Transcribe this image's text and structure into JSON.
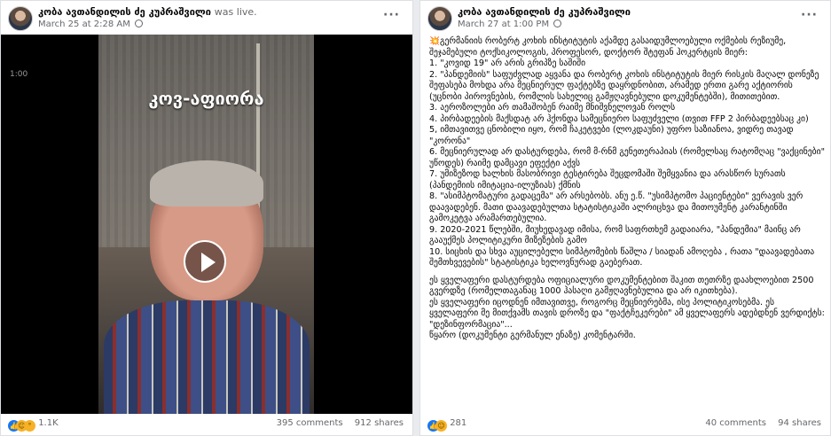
{
  "left_post": {
    "author": "კობა ავთანდილის ძე კუპრაშვილი",
    "status": "was live.",
    "timestamp": "March 25 at 2:28 AM",
    "video": {
      "overlay_title": "კოვ-აფიორა",
      "timecode": "1:00"
    },
    "reactions_count": "1.1K",
    "reactions_icons": [
      "like-icon",
      "haha-icon",
      "wow-icon"
    ],
    "comments": "395 comments",
    "shares": "912 shares"
  },
  "right_post": {
    "author": "კობა ავთანდილის ძე კუპრაშვილი",
    "timestamp": "March 27 at 1:00 PM",
    "paragraphs": [
      "💥გერმანიის რობერტ კოხის ინსტიტუტის აქამდე გასაიდუმლოებული ოქმების რეზიუმე, შეჯამებული ტოქსიკოლოგის, პროფესორ, დოქტორ შტეფან ჰოკერტცის მიერ:",
      "1. \"კოვიდ 19\" არ არის გრიპზე საშიში",
      "2. \"პანდემიის\" საფუძვლად აყვანა და რობერტ კოხის ინსტიტუტის მიერ რისკის მაღალ დონეზე შეფასება მოხდა არა მეცნიერულ ფაქტებზე დაყრდნობით, არამედ ერთი გარე აქტიორის (უცნობი პიროვნების, რომლის სახელიც გამჟღავნებული დოკუმენტებში), მითითებით.",
      "3. აეროზოლები არ თამაშობენ რაიმე მნიშვნელოვან როლს",
      "4. პირბადეების მაქსდატ არ ჰქონდა სამეცნიერო საფუძველი (თვით FFP 2 პირბადეებსაც კი)",
      "5, იმთავითვე ცნობილი იყო, რომ ჩაკეტვები (ლოკდაუნი) უფრო საზიანოა, ვიდრე თავად \"კორონა\"",
      "6. მეცნიერულად არ დასტურდება, რომ მ-რნმ გენეთერაპიას (რომელსაც რატომღაც \"ვაქცინები\" უწოდეს) რაიმე დამცავი ეფექტი აქვს",
      "7. უმიზეზოდ ხალხის მასობრივი ტესტირება შეცდომაში შემყვანია და არასწორ სურათს (პანდემიის იმიტაცია-ილუზიას) ქმნის",
      "8. \"ასიმპტომატური გადაცემა\" არ არსებობს. ანუ ე.წ. \"უსიმპტომო პაციენტები\" ვერავის ვერ დაავადებენ. მათი დაავადებულთა სტატისტიკაში ალრიცხვა და მითოუმენტ კარანტინში გამოკეტვა არამართებულია.",
      "9. 2020-2021 წლებში, მიუხედავად იმისა, რომ საფრთხემ გადაიარა, \"პანდემია\" მაინც არ გააუქმეს პოლიტიკური მიზეზების გამო",
      "10. სიცხის და სხვა აუცილებელი სიმპტომების წაშლა / სიადან ამოღება , რათა \"დაავადებათა შემთხვევების\" სტატისტიკა ხელოვნურად გაებერათ.",
      "ეს ყველაფერი დასტურდება ოფიციალური დოკუმენტებით შაკით თეთრზე დაახლოებით 2500 გვერდზე (რომელთაგანაც 1000 ჰასაღი გამჟღავნებულია და არ იკითხება).",
      "ეს ყველაფერი იცოდნენ იმთავითვე, როგორც მეცნიერებმა, ისე პოლიტიკოსებმა. ეს ყველაფერი მე მითქვამს თავის დროზე და \"ფაქტჩეკერები\" ამ ყველაფერს ადებდნენ ვერდიქტს: \"დეზინფორმაცია\"...",
      "წყარო (დოკუმენტი გერმანულ ენაზე) კომენტარში."
    ],
    "reactions_count": "281",
    "reactions_icons": [
      "like-icon",
      "haha-icon"
    ],
    "comments": "40 comments",
    "shares": "94 shares"
  }
}
